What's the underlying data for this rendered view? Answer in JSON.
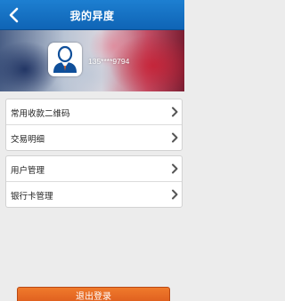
{
  "header": {
    "title": "我的异度"
  },
  "profile": {
    "phone": "135****9794"
  },
  "menu": {
    "group1": [
      {
        "label": "常用收款二维码"
      },
      {
        "label": "交易明细"
      }
    ],
    "group2": [
      {
        "label": "用户管理"
      },
      {
        "label": "银行卡管理"
      }
    ]
  },
  "logout_label": "退出登录",
  "colors": {
    "nav_blue": "#1472c4",
    "logout_orange": "#e8661f"
  },
  "icons": {
    "back": "chevron-left-icon",
    "row": "chevron-right-icon",
    "avatar": "user-icon"
  }
}
